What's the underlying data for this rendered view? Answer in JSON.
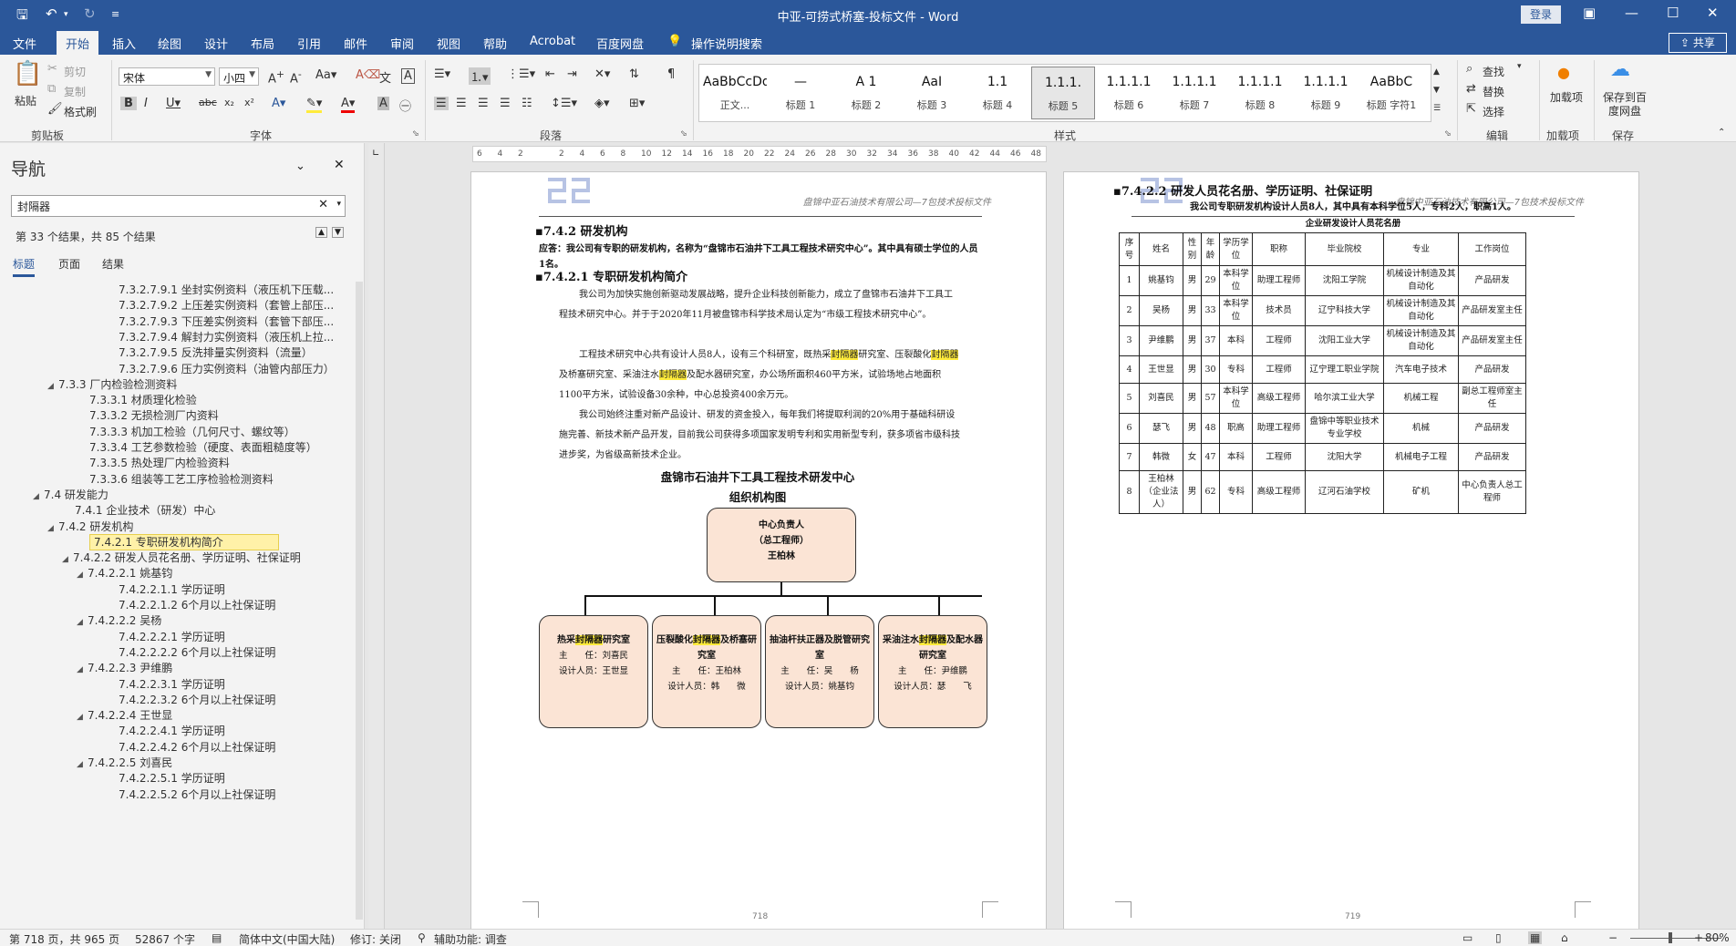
{
  "titlebar": {
    "doc_title": "中亚-可捞式桥塞-投标文件  -  Word",
    "login": "登录"
  },
  "tabs": [
    "文件",
    "开始",
    "插入",
    "绘图",
    "设计",
    "布局",
    "引用",
    "邮件",
    "审阅",
    "视图",
    "帮助",
    "Acrobat",
    "百度网盘",
    "操作说明搜索"
  ],
  "share": "共享",
  "ribbon": {
    "clipboard": {
      "paste": "粘贴",
      "cut": "剪切",
      "copy": "复制",
      "format_painter": "格式刷",
      "label": "剪贴板"
    },
    "font": {
      "name": "宋体",
      "size": "小四",
      "label": "字体"
    },
    "paragraph_label": "段落",
    "styles_label": "样式",
    "styles": [
      {
        "preview": "AaBbCcDdI",
        "name": "正文..."
      },
      {
        "preview": "—",
        "name": "标题 1"
      },
      {
        "preview": "A 1",
        "name": "标题 2"
      },
      {
        "preview": "AaI",
        "name": "标题 3"
      },
      {
        "preview": "1.1",
        "name": "标题 4"
      },
      {
        "preview": "1.1.1.",
        "name": "标题 5"
      },
      {
        "preview": "1.1.1.1",
        "name": "标题 6"
      },
      {
        "preview": "1.1.1.1",
        "name": "标题 7"
      },
      {
        "preview": "1.1.1.1",
        "name": "标题 8"
      },
      {
        "preview": "1.1.1.1",
        "name": "标题 9"
      },
      {
        "preview": "AaBbC",
        "name": "标题 字符1"
      }
    ],
    "editing": {
      "find": "查找",
      "replace": "替换",
      "select": "选择",
      "label": "编辑"
    },
    "addins": {
      "btn": "加载项",
      "label": "加载项"
    },
    "save": {
      "btn": "保存到百度网盘",
      "label": "保存"
    }
  },
  "nav": {
    "title": "导航",
    "search_value": "封隔器",
    "result": "第 33 个结果，共 85 个结果",
    "tabs": [
      "标题",
      "页面",
      "结果"
    ],
    "items": [
      {
        "text": "7.3.2.7.9.1 坐封实例资料（液压机下压载...",
        "indent": 130,
        "tw": ""
      },
      {
        "text": "7.3.2.7.9.2 上压差实例资料（套管上部压...",
        "indent": 130,
        "tw": ""
      },
      {
        "text": "7.3.2.7.9.3 下压差实例资料（套管下部压...",
        "indent": 130,
        "tw": ""
      },
      {
        "text": "7.3.2.7.9.4 解封力实例资料（液压机上拉...",
        "indent": 130,
        "tw": ""
      },
      {
        "text": "7.3.2.7.9.5 反洗排量实例资料（流量）",
        "indent": 130,
        "tw": ""
      },
      {
        "text": "7.3.2.7.9.6 压力实例资料（油管内部压力）",
        "indent": 130,
        "tw": ""
      },
      {
        "text": "7.3.3 厂内检验检测资料",
        "indent": 66,
        "tw": "◢"
      },
      {
        "text": "7.3.3.1 材质理化检验",
        "indent": 98,
        "tw": ""
      },
      {
        "text": "7.3.3.2 无损检测厂内资料",
        "indent": 98,
        "tw": ""
      },
      {
        "text": "7.3.3.3 机加工检验（几何尺寸、螺纹等）",
        "indent": 98,
        "tw": ""
      },
      {
        "text": "7.3.3.4 工艺参数检验（硬度、表面粗糙度等）",
        "indent": 98,
        "tw": ""
      },
      {
        "text": "7.3.3.5 热处理厂内检验资料",
        "indent": 98,
        "tw": ""
      },
      {
        "text": "7.3.3.6 组装等工艺工序检验检测资料",
        "indent": 98,
        "tw": ""
      },
      {
        "text": "7.4 研发能力",
        "indent": 50,
        "tw": "◢"
      },
      {
        "text": "7.4.1 企业技术（研发）中心",
        "indent": 82,
        "tw": ""
      },
      {
        "text": "7.4.2 研发机构",
        "indent": 66,
        "tw": "◢"
      },
      {
        "text": "7.4.2.1 专职研发机构简介",
        "indent": 98,
        "tw": "",
        "hl": true
      },
      {
        "text": "7.4.2.2 研发人员花名册、学历证明、社保证明",
        "indent": 82,
        "tw": "◢"
      },
      {
        "text": "7.4.2.2.1 姚基钧",
        "indent": 98,
        "tw": "◢"
      },
      {
        "text": "7.4.2.2.1.1 学历证明",
        "indent": 130,
        "tw": ""
      },
      {
        "text": "7.4.2.2.1.2 6个月以上社保证明",
        "indent": 130,
        "tw": ""
      },
      {
        "text": "7.4.2.2.2 吴杨",
        "indent": 98,
        "tw": "◢"
      },
      {
        "text": "7.4.2.2.2.1 学历证明",
        "indent": 130,
        "tw": ""
      },
      {
        "text": "7.4.2.2.2.2 6个月以上社保证明",
        "indent": 130,
        "tw": ""
      },
      {
        "text": "7.4.2.2.3 尹维鹏",
        "indent": 98,
        "tw": "◢"
      },
      {
        "text": "7.4.2.2.3.1 学历证明",
        "indent": 130,
        "tw": ""
      },
      {
        "text": "7.4.2.2.3.2 6个月以上社保证明",
        "indent": 130,
        "tw": ""
      },
      {
        "text": "7.4.2.2.4 王世显",
        "indent": 98,
        "tw": "◢"
      },
      {
        "text": "7.4.2.2.4.1 学历证明",
        "indent": 130,
        "tw": ""
      },
      {
        "text": "7.4.2.2.4.2 6个月以上社保证明",
        "indent": 130,
        "tw": ""
      },
      {
        "text": "7.4.2.2.5 刘喜民",
        "indent": 98,
        "tw": "◢"
      },
      {
        "text": "7.4.2.2.5.1 学历证明",
        "indent": 130,
        "tw": ""
      },
      {
        "text": "7.4.2.2.5.2 6个月以上社保证明",
        "indent": 130,
        "tw": ""
      }
    ]
  },
  "ruler": [
    "6",
    "4",
    "2",
    "",
    "2",
    "4",
    "6",
    "8",
    "10",
    "12",
    "14",
    "16",
    "18",
    "20",
    "22",
    "24",
    "26",
    "28",
    "30",
    "32",
    "34",
    "36",
    "38",
    "40",
    "42",
    "44",
    "46",
    "48"
  ],
  "page1": {
    "header": "盘锦中亚石油技术有限公司—7包技术投标文件",
    "h742": "7.4.2 研发机构",
    "answer": "应答：我公司有专职的研发机构，名称为“盘锦市石油井下工具工程技术研究中心”。其中具有硕士学位的人员1名。",
    "h7421": "7.4.2.1 专职研发机构简介",
    "p1": "我公司为加快实施创新驱动发展战略，提升企业科技创新能力，成立了盘锦市石油井下工具工程技术研究中心。并于于2020年11月被盘锦市科学技术局认定为“市级工程技术研究中心”。",
    "p2": "工程技术研究中心共有设计人员8人，设有三个科研室，既热采封隔器研究室、压裂酸化封隔器及桥塞研究室、采油注水封隔器及配水器研究室，办公场所面积460平方米，试验场地占地面积1100平方米，试验设备30余种，中心总投资400余万元。",
    "p3": "我公司始终注重对新产品设计、研发的资金投入，每年我们将提取利润的20%用于基础科研设施完善、新技术新产品开发，目前我公司获得多项国家发明专利和实用新型专利，获多项省市级科技进步奖，为省级高新技术企业。",
    "org_title": "盘锦市石油井下工具工程技术研发中心",
    "org_subtitle": "组织机构图",
    "root": {
      "line1": "中心负责人",
      "line2": "（总工程师）",
      "line3": "王柏林"
    },
    "units": [
      {
        "title": "热采封隔器研究室",
        "lead": "主　　任：刘喜民",
        "staff": "设计人员：王世显"
      },
      {
        "title": "压裂酸化封隔器及桥塞研究室",
        "lead": "主　　任：王柏林",
        "staff": "设计人员：韩　　微"
      },
      {
        "title": "抽油杆扶正器及脱管研究室",
        "lead": "主　　任：吴　　杨",
        "staff": "设计人员：姚基钧"
      },
      {
        "title": "采油注水封隔器及配水器研究室",
        "lead": "主　　任：尹维鹏",
        "staff": "设计人员：瑟　　飞"
      }
    ],
    "page_num": "718"
  },
  "page2": {
    "header": "盘锦中亚石油技术有限公司—7包技术投标文件",
    "h7422": "7.4.2.2 研发人员花名册、学历证明、社保证明",
    "summary": "我公司专职研发机构设计人员8人，其中具有本科学位5人，专科2人，职高1人。",
    "table_title": "企业研发设计人员花名册",
    "columns": [
      "序号",
      "姓名",
      "性别",
      "年龄",
      "学历学位",
      "职称",
      "毕业院校",
      "专业",
      "工作岗位"
    ],
    "rows": [
      [
        "1",
        "姚基钧",
        "男",
        "29",
        "本科学位",
        "助理工程师",
        "沈阳工学院",
        "机械设计制造及其自动化",
        "产品研发"
      ],
      [
        "2",
        "吴杨",
        "男",
        "33",
        "本科学位",
        "技术员",
        "辽宁科技大学",
        "机械设计制造及其自动化",
        "产品研发室主任"
      ],
      [
        "3",
        "尹维鹏",
        "男",
        "37",
        "本科",
        "工程师",
        "沈阳工业大学",
        "机械设计制造及其自动化",
        "产品研发室主任"
      ],
      [
        "4",
        "王世显",
        "男",
        "30",
        "专科",
        "工程师",
        "辽宁理工职业学院",
        "汽车电子技术",
        "产品研发"
      ],
      [
        "5",
        "刘喜民",
        "男",
        "57",
        "本科学位",
        "高级工程师",
        "哈尔滨工业大学",
        "机械工程",
        "副总工程师室主任"
      ],
      [
        "6",
        "瑟飞",
        "男",
        "48",
        "职高",
        "助理工程师",
        "盘锦中等职业技术专业学校",
        "机械",
        "产品研发"
      ],
      [
        "7",
        "韩微",
        "女",
        "47",
        "本科",
        "工程师",
        "沈阳大学",
        "机械电子工程",
        "产品研发"
      ],
      [
        "8",
        "王柏林（企业法人）",
        "男",
        "62",
        "专科",
        "高级工程师",
        "辽河石油学校",
        "矿机",
        "中心负责人总工程师"
      ]
    ],
    "page_num": "719"
  },
  "status": {
    "page": "第 718 页，共 965 页",
    "words": "52867 个字",
    "lang": "简体中文(中国大陆)",
    "revision": "修订: 关闭",
    "accessibility": "辅助功能: 调查",
    "zoom": "80%"
  },
  "colors": {
    "accent": "#2b579a",
    "highlight": "#ffeb3b",
    "org_fill": "#fbe4d5"
  }
}
